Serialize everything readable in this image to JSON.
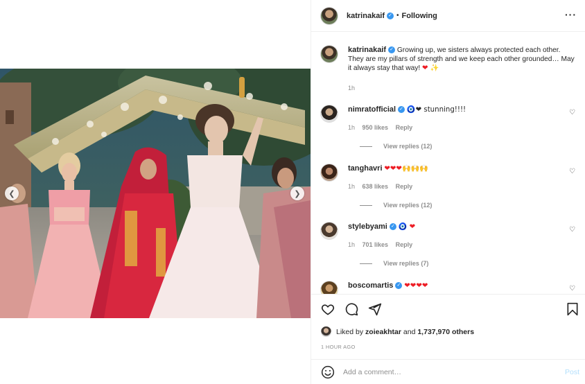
{
  "header": {
    "username": "katrinakaif",
    "verified_icon": "verified-badge-icon",
    "separator": "•",
    "follow_status": "Following",
    "more_icon": "more-horizontal-icon"
  },
  "media": {
    "prev_icon": "chevron-left-icon",
    "next_icon": "chevron-right-icon"
  },
  "caption": {
    "username": "katrinakaif",
    "text": "Growing up, we sisters always protected each other. They are my pillars of strength and we keep each other grounded… May it always stay that way!",
    "emojis": "❤ ✨",
    "time": "1h"
  },
  "comments": [
    {
      "username": "nimratofficial",
      "text": "🧿❤ stunning!!!!",
      "time": "1h",
      "likes": "950 likes",
      "reply": "Reply",
      "view_replies": "View replies (12)"
    },
    {
      "username": "tanghavri",
      "text": "❤❤❤🙌🙌🙌",
      "time": "1h",
      "likes": "638 likes",
      "reply": "Reply",
      "view_replies": "View replies (12)"
    },
    {
      "username": "stylebyami",
      "text": "🧿 ❤",
      "time": "1h",
      "likes": "701 likes",
      "reply": "Reply",
      "view_replies": "View replies (7)"
    },
    {
      "username": "boscomartis",
      "text": "❤❤❤❤",
      "time": "",
      "likes": "",
      "reply": "",
      "view_replies": ""
    }
  ],
  "actions": {
    "like_icon": "heart-icon",
    "comment_icon": "comment-icon",
    "share_icon": "share-icon",
    "save_icon": "bookmark-icon"
  },
  "likes": {
    "prefix": "Liked by",
    "user": "zoieakhtar",
    "suffix": "and",
    "others": "1,737,970 others"
  },
  "time_ago": "1 HOUR AGO",
  "add_comment": {
    "placeholder": "Add a comment…",
    "post_label": "Post",
    "emoji_icon": "smiley-icon"
  },
  "colors": {
    "verified": "#3897f0",
    "post_button": "#b2dffc",
    "heart_red": "#ed1c24"
  }
}
